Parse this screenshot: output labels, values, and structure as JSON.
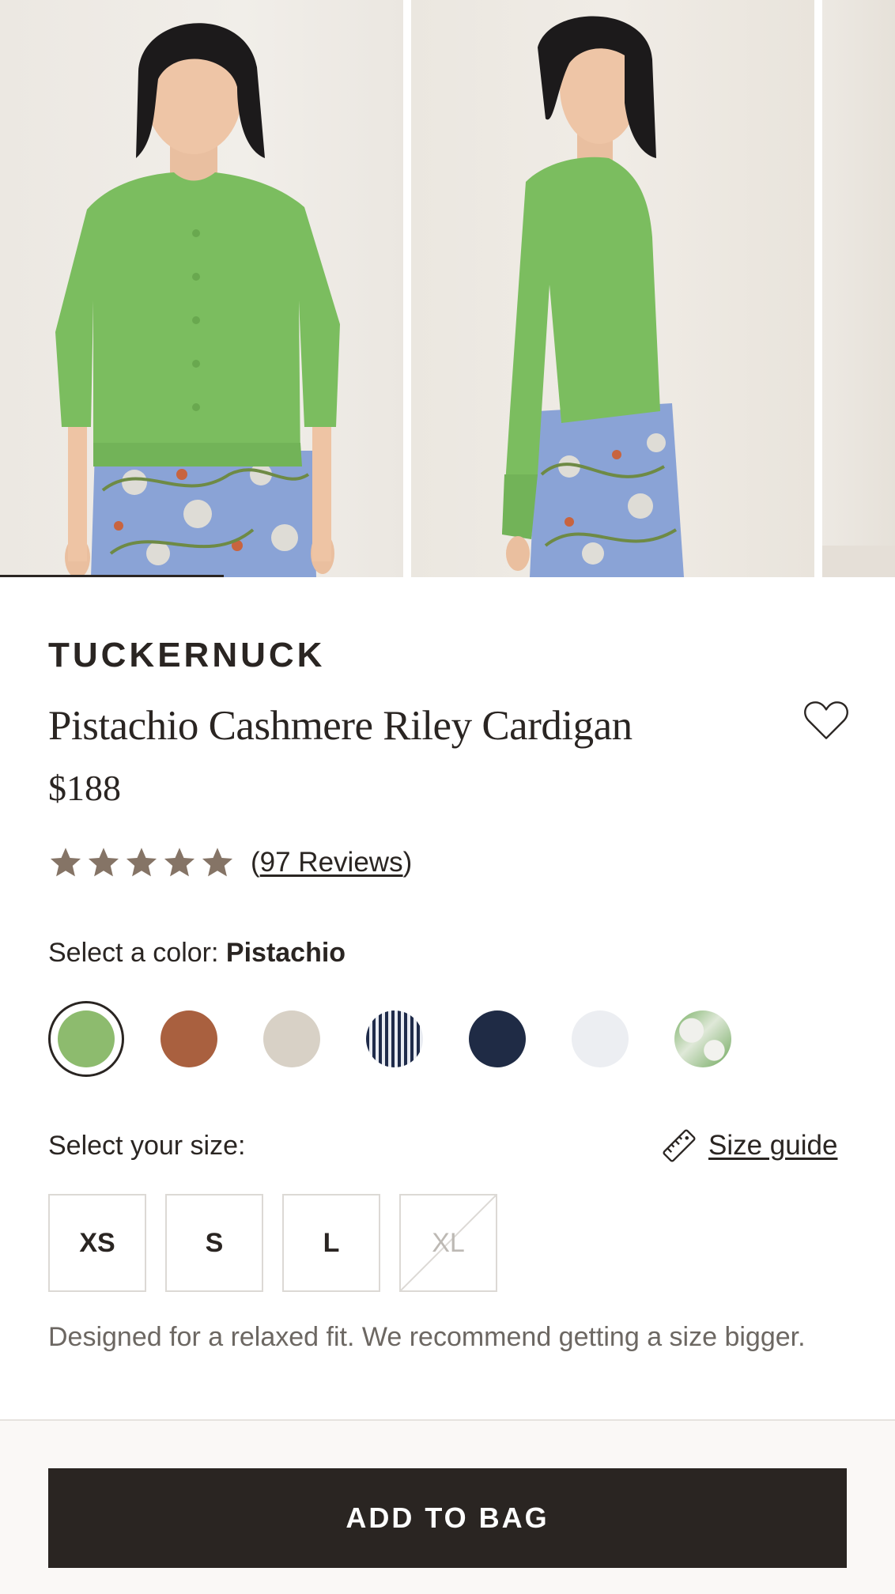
{
  "gallery": {
    "images": [
      {
        "alt": "model-front-view"
      },
      {
        "alt": "model-side-view"
      },
      {
        "alt": "partial-next-image"
      }
    ]
  },
  "product": {
    "brand": "TUCKERNUCK",
    "title": "Pistachio Cashmere Riley Cardigan",
    "price": "$188",
    "rating": {
      "stars": 5,
      "max_stars": 5,
      "reviews_label": "97 Reviews"
    },
    "wishlist_icon": "heart-outline-icon"
  },
  "color": {
    "label": "Select a color:",
    "selected_name": "Pistachio",
    "swatches": [
      {
        "name": "pistachio",
        "color": "#8dbb6e",
        "selected": true
      },
      {
        "name": "rust",
        "color": "#a9603f"
      },
      {
        "name": "oatmeal",
        "color": "#d8d1c6"
      },
      {
        "name": "navy-stripe",
        "color": "#24324e"
      },
      {
        "name": "navy",
        "color": "#1f2b45"
      },
      {
        "name": "white",
        "color": "#eceef2"
      },
      {
        "name": "green-print",
        "color": "#79b066"
      }
    ]
  },
  "size": {
    "label": "Select your size:",
    "guide_label": "Size guide",
    "guide_icon": "ruler-icon",
    "options": [
      {
        "label": "XS",
        "available": true
      },
      {
        "label": "S",
        "available": true
      },
      {
        "label": "L",
        "available": true
      },
      {
        "label": "XL",
        "available": false
      }
    ],
    "fit_note": "Designed for a relaxed fit. We recommend getting a size bigger."
  },
  "cta": {
    "add_to_bag": "ADD TO BAG"
  },
  "colors": {
    "text": "#2a2522",
    "star": "#857466",
    "cta_bg": "#2a2522",
    "muted": "#6c6762"
  }
}
